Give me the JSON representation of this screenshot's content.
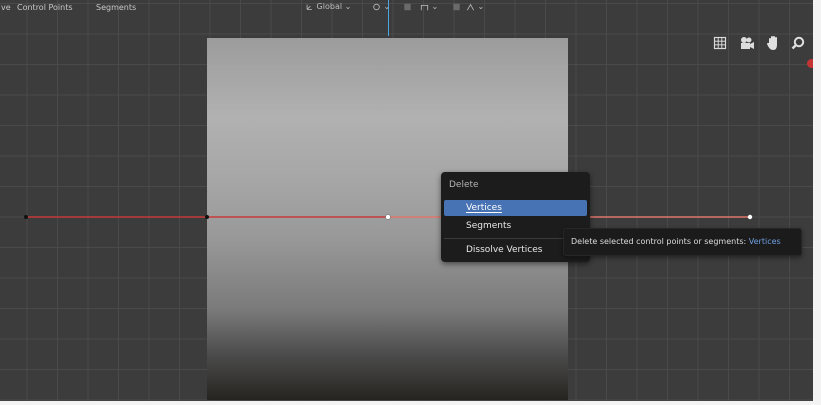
{
  "header": {
    "menus": [
      "ve",
      "Control Points",
      "Segments"
    ],
    "transform_orientation": "Global",
    "orientation_dropdown_icon": "chevron-down-icon"
  },
  "gizmos": {
    "icons": [
      "grid-icon",
      "camera-icon",
      "hand-icon",
      "zoom-icon"
    ]
  },
  "delete_menu": {
    "title": "Delete",
    "options": [
      "Vertices",
      "Segments",
      "Dissolve Vertices"
    ],
    "active_option": "Vertices"
  },
  "tooltip": {
    "text": "Delete selected control points or segments:",
    "value": "Vertices"
  },
  "colors": {
    "curve_selected": "#c83a3a",
    "menu_highlight": "#4772b3",
    "tooltip_value": "#6e9fe3",
    "record_indicator": "#c53434"
  }
}
